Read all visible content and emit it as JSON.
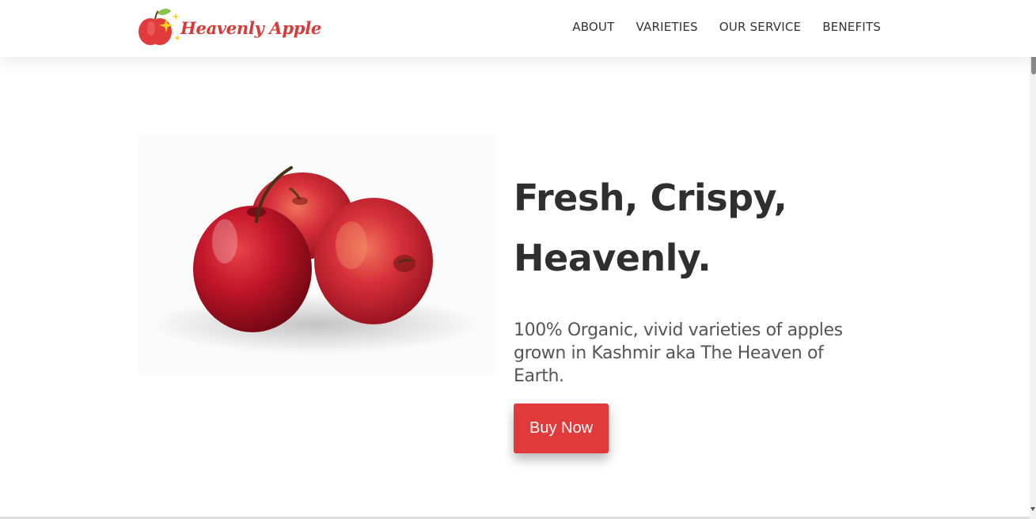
{
  "brand": {
    "name": "Heavenly Apple",
    "logo_icon": "apple-sparkle-logo"
  },
  "nav": {
    "items": [
      {
        "label": "ABOUT"
      },
      {
        "label": "VARIETIES"
      },
      {
        "label": "OUR SERVICE"
      },
      {
        "label": "BENEFITS"
      }
    ]
  },
  "hero": {
    "title_line1": "Fresh, Crispy,",
    "title_line2": "Heavenly.",
    "description": "100% Organic, vivid varieties of apples grown in Kashmir aka The Heaven of Earth.",
    "cta_label": "Buy Now",
    "image_icon": "three-red-apples-image"
  },
  "colors": {
    "accent": "#e03a3a",
    "brand_text": "#d83a3a",
    "title": "#2f2f2f",
    "body": "#555555"
  }
}
